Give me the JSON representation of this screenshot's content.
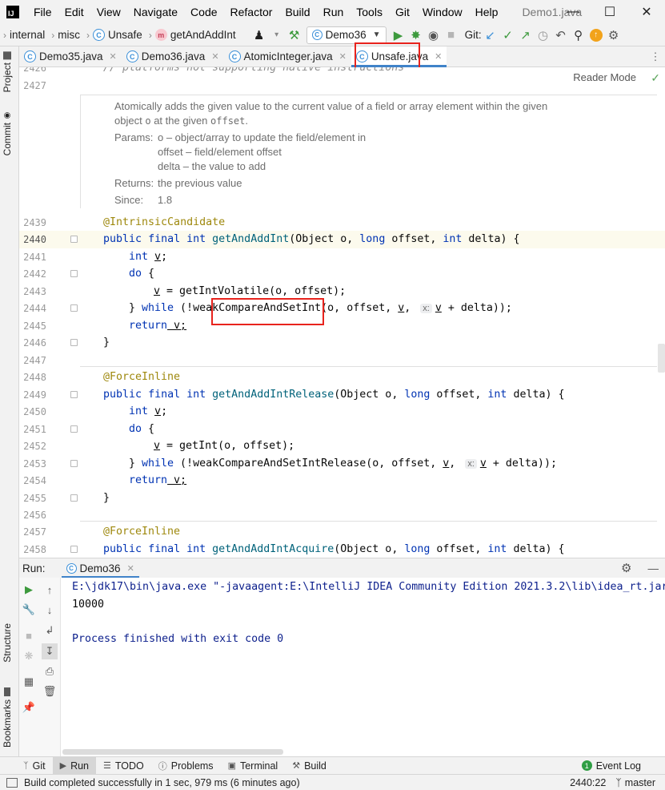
{
  "menu": {
    "items": [
      "File",
      "Edit",
      "View",
      "Navigate",
      "Code",
      "Refactor",
      "Build",
      "Run",
      "Tools",
      "Git",
      "Window",
      "Help"
    ],
    "title": "Demo1.java"
  },
  "breadcrumb": {
    "items": [
      "internal",
      "misc",
      "Unsafe",
      "getAndAddInt"
    ]
  },
  "toolbar": {
    "run_config": "Demo36",
    "git_label": "Git:"
  },
  "tabs": [
    {
      "label": "Demo35.java"
    },
    {
      "label": "Demo36.java"
    },
    {
      "label": "AtomicInteger.java"
    },
    {
      "label": "Unsafe.java"
    }
  ],
  "side_panels": {
    "project": "Project",
    "commit": "Commit",
    "structure": "Structure",
    "bookmarks": "Bookmarks"
  },
  "editor": {
    "reader_mode": "Reader Mode",
    "top_line_num": "2426",
    "top_line_text": "// platforms not supporting native instructions",
    "line_2427": "2427",
    "doc": {
      "summary1": "Atomically adds the given value to the current value of a field or array element within the given",
      "summary2_a": "object",
      "summary2_b": "o",
      "summary2_c": "at the given",
      "summary2_d": "offset",
      "summary2_e": ".",
      "params_key": "Params:",
      "param1": "o – object/array to update the field/element in",
      "param2": "offset – field/element offset",
      "param3": "delta – the value to add",
      "returns_key": "Returns:",
      "returns_val": "the previous value",
      "since_key": "Since:",
      "since_val": "1.8"
    },
    "lines": {
      "n2439": "2439",
      "n2440": "2440",
      "n2441": "2441",
      "n2442": "2442",
      "n2443": "2443",
      "n2444": "2444",
      "n2445": "2445",
      "n2446": "2446",
      "n2447": "2447",
      "n2448": "2448",
      "n2449": "2449",
      "n2450": "2450",
      "n2451": "2451",
      "n2452": "2452",
      "n2453": "2453",
      "n2454": "2454",
      "n2455": "2455",
      "n2456": "2456",
      "n2457": "2457",
      "n2458": "2458"
    },
    "code": {
      "ann_intrinsic": "@IntrinsicCandidate",
      "ann_force": "@ForceInline",
      "public": "public",
      "final": "final",
      "int": "int",
      "long": "long",
      "do": "do",
      "while": "while",
      "return": "return",
      "m1": "getAndAddInt",
      "m2": "getAndAddIntRelease",
      "m3": "getAndAddIntAcquire",
      "params": "(Object o, ",
      "offset_p": " offset, ",
      "delta_p": " delta) {",
      "v": "v",
      "semi": ";",
      "brace_open": "{",
      "brace_close": "}",
      "brace_close_sp": "} ",
      "assign": " = ",
      "getIntVolatile": "getIntVolatile(o, offset);",
      "getInt": "getInt(o, offset);",
      "weak1_a": " (!weakCompareAndSetInt(o, offset, ",
      "weak2_a": " (!weakCompareAndSetIntRelease(o, offset, ",
      "comma": ", ",
      "hint_x": "x:",
      "weak_end": " + delta));",
      "return_v": " v;"
    }
  },
  "run": {
    "label": "Run:",
    "tab": "Demo36",
    "cmd": "E:\\jdk17\\bin\\java.exe \"-javaagent:E:\\IntelliJ IDEA Community Edition 2021.3.2\\lib\\idea_rt.jar=6",
    "output": "10000",
    "finish": "Process finished with exit code 0"
  },
  "bottom_tabs": [
    "Git",
    "Run",
    "TODO",
    "Problems",
    "Terminal",
    "Build"
  ],
  "event_log": "Event Log",
  "status": {
    "message": "Build completed successfully in 1 sec, 979 ms (6 minutes ago)",
    "position": "2440:22",
    "branch": "master"
  },
  "colors": {
    "keyword": "#0033b3",
    "annotation": "#9e880d",
    "method": "#00627a",
    "highlight_box": "#e8231d",
    "active_tab_underline": "#4083c9"
  }
}
